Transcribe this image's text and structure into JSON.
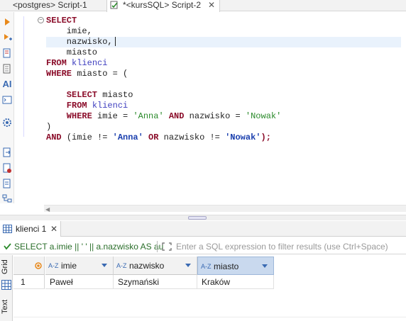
{
  "tabs": [
    {
      "label": "<postgres> Script-1",
      "active": false
    },
    {
      "label": "*<kursSQL> Script-2",
      "active": true
    }
  ],
  "left_toolbar": [
    "run-icon",
    "run-script-icon",
    "explain-icon",
    "load-plan-icon",
    "ai-icon",
    "console-icon",
    "settings-icon",
    "export-icon",
    "import-icon",
    "script-icon",
    "outline-icon"
  ],
  "ai_label": "AI",
  "editor": {
    "lines": [
      [
        {
          "t": "SELECT",
          "c": "kw"
        }
      ],
      [
        {
          "t": "    imie,",
          "c": "id"
        }
      ],
      [
        {
          "t": "    nazwisko,",
          "c": "id"
        }
      ],
      [
        {
          "t": "    miasto",
          "c": "id"
        }
      ],
      [
        {
          "t": "FROM ",
          "c": "kw"
        },
        {
          "t": "klienci",
          "c": "tbl"
        }
      ],
      [
        {
          "t": "WHERE ",
          "c": "kw"
        },
        {
          "t": "miasto = (",
          "c": "id"
        }
      ],
      [
        {
          "t": "",
          "c": "id"
        }
      ],
      [
        {
          "t": "    SELECT ",
          "c": "kw"
        },
        {
          "t": "miasto",
          "c": "id"
        }
      ],
      [
        {
          "t": "    FROM ",
          "c": "kw"
        },
        {
          "t": "klienci",
          "c": "tbl"
        }
      ],
      [
        {
          "t": "    WHERE ",
          "c": "kw"
        },
        {
          "t": "imie = ",
          "c": "id"
        },
        {
          "t": "'Anna'",
          "c": "str"
        },
        {
          "t": " AND ",
          "c": "kw"
        },
        {
          "t": "nazwisko = ",
          "c": "id"
        },
        {
          "t": "'Nowak'",
          "c": "str"
        }
      ],
      [
        {
          "t": ")",
          "c": "id"
        }
      ],
      [
        {
          "t": "AND ",
          "c": "kw"
        },
        {
          "t": "(imie != ",
          "c": "id"
        },
        {
          "t": "'Anna'",
          "c": "str2"
        },
        {
          "t": " OR ",
          "c": "kw"
        },
        {
          "t": "nazwisko != ",
          "c": "id"
        },
        {
          "t": "'Nowak'",
          "c": "str2"
        },
        {
          "t": ");",
          "c": "kw"
        }
      ]
    ],
    "current_line": 2
  },
  "results": {
    "tab_label": "klienci 1",
    "filter_query": "SELECT a.imie || ' ' || a.nazwisko AS au",
    "filter_placeholder": "Enter a SQL expression to filter results (use Ctrl+Space)",
    "side_tabs": {
      "grid": "Grid",
      "text": "Text"
    },
    "columns": [
      {
        "name": "imie",
        "type_icon": "A-Z",
        "selected": false
      },
      {
        "name": "nazwisko",
        "type_icon": "A-Z",
        "selected": false
      },
      {
        "name": "miasto",
        "type_icon": "A-Z",
        "selected": true
      }
    ],
    "rows": [
      {
        "num": "1",
        "cells": [
          "Paweł",
          "Szymański",
          "Kraków"
        ]
      }
    ]
  },
  "colors": {
    "keyword": "#8b0d2a",
    "table": "#3f3fbf",
    "string": "#2a8a2a",
    "filter_query": "#2a6e2a",
    "selected_header": "#c9d9ee"
  }
}
